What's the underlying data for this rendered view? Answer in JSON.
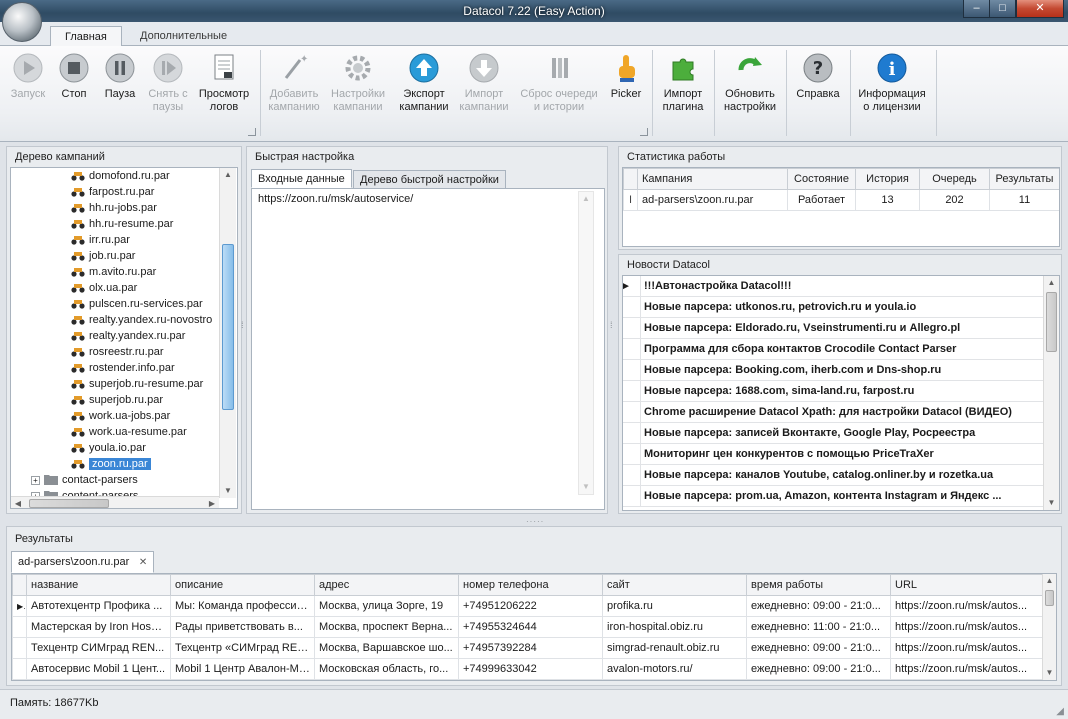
{
  "window": {
    "title": "Datacol 7.22 (Easy Action)",
    "min": "–",
    "max": "□",
    "close": "✕"
  },
  "ribbon_tabs": {
    "main": "Главная",
    "extra": "Дополнительные"
  },
  "ribbon": {
    "start": "Запуск",
    "stop": "Стоп",
    "pause": "Пауза",
    "unpause": [
      "Снять с",
      "паузы"
    ],
    "logs": [
      "Просмотр",
      "логов"
    ],
    "add_campaign": [
      "Добавить",
      "кампанию"
    ],
    "campaign_settings": [
      "Настройки",
      "кампании"
    ],
    "export": [
      "Экспорт",
      "кампании"
    ],
    "import": [
      "Импорт",
      "кампании"
    ],
    "reset": [
      "Сброс очереди",
      "и истории"
    ],
    "picker": "Picker",
    "import_plugin": [
      "Импорт",
      "плагина"
    ],
    "update_settings": [
      "Обновить",
      "настройки"
    ],
    "help": "Справка",
    "license": [
      "Информация",
      "о лицензии"
    ]
  },
  "tree": {
    "title": "Дерево кампаний",
    "items": [
      "domofond.ru.par",
      "farpost.ru.par",
      "hh.ru-jobs.par",
      "hh.ru-resume.par",
      "irr.ru.par",
      "job.ru.par",
      "m.avito.ru.par",
      "olx.ua.par",
      "pulscen.ru-services.par",
      "realty.yandex.ru-novostro",
      "realty.yandex.ru.par",
      "rosreestr.ru.par",
      "rostender.info.par",
      "superjob.ru-resume.par",
      "superjob.ru.par",
      "work.ua-jobs.par",
      "work.ua-resume.par",
      "youla.io.par",
      "zoon.ru.par"
    ],
    "folders": [
      "contact-parsers",
      "content-parsers"
    ]
  },
  "quick": {
    "title": "Быстрая настройка",
    "tab_input": "Входные данные",
    "tab_tree": "Дерево быстрой настройки",
    "input_value": "https://zoon.ru/msk/autoservice/"
  },
  "stats": {
    "title": "Статистика работы",
    "headers": [
      "Кампания",
      "Состояние",
      "История",
      "Очередь",
      "Результаты"
    ],
    "row": {
      "campaign": "ad-parsers\\zoon.ru.par",
      "state": "Работает",
      "history": "13",
      "queue": "202",
      "results": "11"
    }
  },
  "news": {
    "title": "Новости Datacol",
    "items": [
      "!!!Автонастройка Datacol!!!",
      "Новые парсера: utkonos.ru, petrovich.ru и youla.io",
      "Новые парсера: Eldorado.ru, Vseinstrumenti.ru и Allegro.pl",
      "Программа для  сбора контактов Crocodile Contact Parser",
      "Новые парсера: Booking.com, iherb.com и Dns-shop.ru",
      "Новые парсера: 1688.com, sima-land.ru, farpost.ru",
      "Chrome расширение Datacol Xpath: для настройки Datacol (ВИДЕО)",
      "Новые парсера: записей Вконтакте, Google Play, Росреестра",
      "Мониторинг цен конкурентов с помощью PriceTraXer",
      "Новые парсера: каналов Youtube, catalog.onliner.by и rozetka.ua",
      "Новые парсера: prom.ua, Amazon, контента Instagram и Яндекс ..."
    ]
  },
  "results": {
    "title": "Результаты",
    "tab_label": "ad-parsers\\zoon.ru.par",
    "tab_close": "✕",
    "headers": [
      "название",
      "описание",
      "адрес",
      "номер телефона",
      "сайт",
      "время работы",
      "URL"
    ],
    "rows": [
      [
        "Автотехцентр Профика ...",
        "Мы: Команда профессио...",
        "Москва, улица Зорге, 19",
        "+74951206222",
        "profika.ru",
        "ежедневно: 09:00 - 21:0...",
        "https://zoon.ru/msk/autos..."
      ],
      [
        "Мастерская by Iron Hosp...",
        "Рады приветствовать в...",
        "Москва, проспект Верна...",
        "+74955324644",
        "iron-hospital.obiz.ru",
        "ежедневно: 11:00 - 21:0...",
        "https://zoon.ru/msk/autos..."
      ],
      [
        "Техцентр СИМград REN...",
        "Техцентр «СИМград REN...",
        "Москва, Варшавское шо...",
        "+74957392284",
        "simgrad-renault.obiz.ru",
        "ежедневно: 09:00 - 21:0...",
        "https://zoon.ru/msk/autos..."
      ],
      [
        "Автосервис Mobil 1 Цент...",
        "Mobil 1 Центр Авалон-Мо...",
        "Московская область, го...",
        "+74999633042",
        "avalon-motors.ru/",
        "ежедневно: 09:00 - 21:0...",
        "https://zoon.ru/msk/autos..."
      ]
    ]
  },
  "status": {
    "memory": "Память: 18677Kb"
  },
  "colors": {
    "accent": "#3a86d6",
    "title_bar": "#2f4b63",
    "close": "#c44a32"
  }
}
